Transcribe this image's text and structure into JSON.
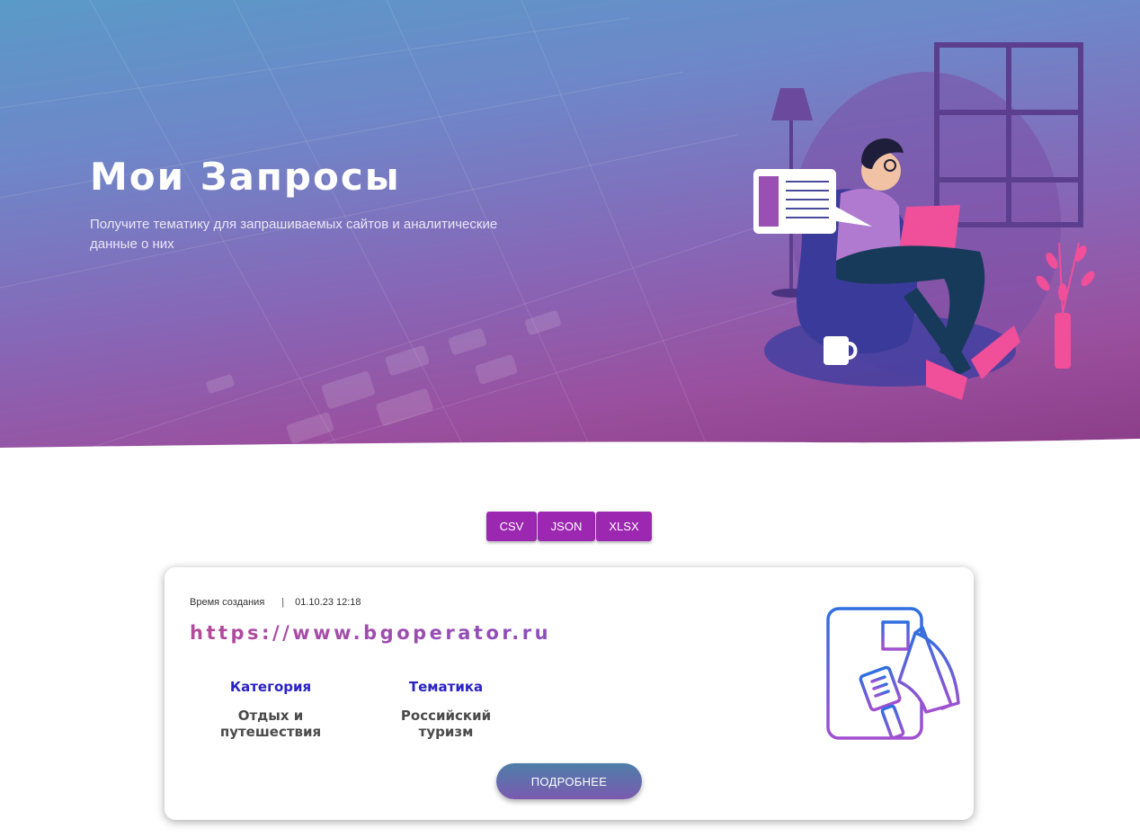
{
  "hero": {
    "title": "Мои Запросы",
    "subtitle": "Получите тематику для запрашиваемых сайтов и аналитические данные о них"
  },
  "exports": {
    "csv": "CSV",
    "json": "JSON",
    "xlsx": "XLSX"
  },
  "request_card": {
    "created_label": "Время создания",
    "created_separator": "|",
    "created_value": "01.10.23 12:18",
    "url": "https://www.bgoperator.ru",
    "category_label": "Категория",
    "category_value": "Отдых и путешествия",
    "topic_label": "Тематика",
    "topic_value": "Российский туризм",
    "more_button": "ПОДРОБНЕЕ",
    "icon": "news-megaphone-icon"
  },
  "colors": {
    "accent": "#9c27b0",
    "heading": "#2a22c4",
    "url_gradient_start": "#b44a9a",
    "url_gradient_end": "#8b4fbf"
  }
}
